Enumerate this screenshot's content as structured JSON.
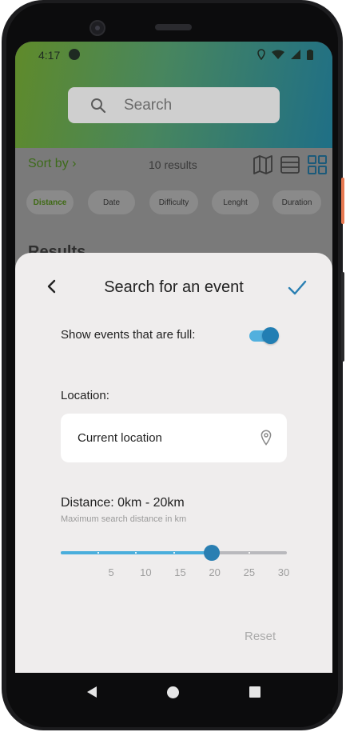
{
  "status_bar": {
    "time": "4:17"
  },
  "background_screen": {
    "search_placeholder": "Search",
    "sort_label": "Sort by ›",
    "results_count": "10 results",
    "filter_chips": [
      "Distance",
      "Date",
      "Difficulty",
      "Lenght",
      "Duration"
    ],
    "active_chip": "Distance",
    "results_heading_peek": "Results"
  },
  "sheet": {
    "title": "Search for an event",
    "show_full_label": "Show events that are full:",
    "show_full_enabled": true,
    "location_label": "Location:",
    "location_value": "Current location",
    "distance_label": "Distance: 0km - 20km",
    "distance_hint": "Maximum search distance in km",
    "slider": {
      "min": 0,
      "max": 30,
      "value": 20,
      "ticks": [
        5,
        10,
        15,
        20,
        25,
        30
      ]
    },
    "reset_label": "Reset"
  },
  "colors": {
    "accent": "#2a7fb2",
    "accent_light": "#4aaedc",
    "sheet_bg": "#efeded",
    "header_gradient": [
      "#5f8a2a",
      "#1f6f86"
    ]
  },
  "icons": [
    "back-chevron-icon",
    "check-icon",
    "location-pin-icon",
    "search-icon",
    "map-view-icon",
    "list-view-icon",
    "grid-view-icon",
    "nav-back-icon",
    "nav-home-icon",
    "nav-recent-icon"
  ]
}
